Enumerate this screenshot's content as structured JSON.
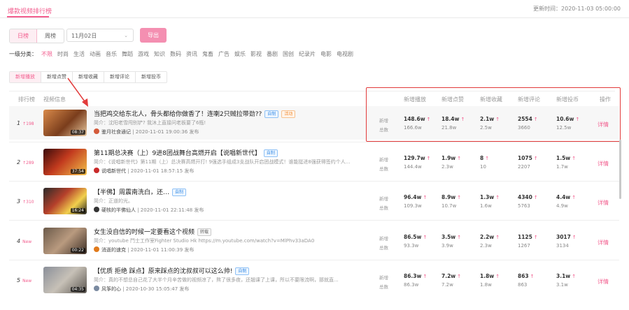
{
  "header": {
    "tab": "爆款视频排行榜",
    "update_label": "更新时间：2020-11-03 05:00:00"
  },
  "filters": {
    "period_tabs": [
      {
        "label": "日榜",
        "active": true
      },
      {
        "label": "周榜",
        "active": false
      }
    ],
    "date_value": "11月02日",
    "export_label": "导出",
    "category_label": "一级分类：",
    "categories": [
      "不限",
      "时尚",
      "生活",
      "动画",
      "音乐",
      "舞蹈",
      "游戏",
      "知识",
      "数码",
      "资讯",
      "鬼畜",
      "广告",
      "娱乐",
      "影视",
      "番剧",
      "国创",
      "纪录片",
      "电影",
      "电视剧"
    ]
  },
  "metric_tabs": [
    "新增播放",
    "新增点赞",
    "新增收藏",
    "新增评论",
    "新增投币"
  ],
  "table": {
    "col_rank": "排行榜",
    "col_info": "视频信息",
    "metric_cols": [
      "新增播放",
      "新增点赞",
      "新增收藏",
      "新增评论",
      "新增投币"
    ],
    "col_action": "操作",
    "label_new": "新增",
    "label_total": "总数",
    "action_label": "详情",
    "rows": [
      {
        "rank": "1",
        "delta": "↑198",
        "title": "当把鸡交给东北人，骨头都给你做香了！连喇2只贼拉带劲??",
        "tags": [
          {
            "t": "自制",
            "c": "blue"
          },
          {
            "t": "活动",
            "c": "orange"
          }
        ],
        "desc": "简介：沈阳老雪闯别铲? 我沐上直接问老板要了6瓶!",
        "author": "鉴月社食通记",
        "meta": " | 2020-11-01 19:00:36 发布",
        "duration": "08:37",
        "metrics": [
          {
            "n": "148.6w",
            "t": "166.6w"
          },
          {
            "n": "18.4w",
            "t": "21.8w"
          },
          {
            "n": "2.1w",
            "t": "2.5w"
          },
          {
            "n": "2554",
            "t": "3660"
          },
          {
            "n": "10.6w",
            "t": "12.5w"
          }
        ]
      },
      {
        "rank": "2",
        "delta": "↑289",
        "title": "第11期总决赛（上）9进8团战舞台高燃开启【说唱新世代】",
        "tags": [
          {
            "t": "自制",
            "c": "blue"
          }
        ],
        "desc": "简介：《说唱新世代》第11期（上）总决赛高燃开打! 9强选手组成3支战队开启团战模式！谁能挺进8强获得签约个人...",
        "author": "说唱新世代",
        "meta": " | 2020-11-01 18:57:15 发布",
        "duration": "37:54",
        "metrics": [
          {
            "n": "129.7w",
            "t": "144.4w"
          },
          {
            "n": "1.9w",
            "t": "2.3w"
          },
          {
            "n": "8",
            "t": "10"
          },
          {
            "n": "1075",
            "t": "2207"
          },
          {
            "n": "1.5w",
            "t": "1.7w"
          }
        ]
      },
      {
        "rank": "3",
        "delta": "↑310",
        "title": "【半佛】周震南洗白，还…",
        "tags": [
          {
            "t": "自制",
            "c": "blue"
          }
        ],
        "desc": "简介：正道的光。",
        "author": "硬核的半佛仙人",
        "meta": " | 2020-11-01 22:11:48 发布",
        "duration": "16:24",
        "metrics": [
          {
            "n": "96.4w",
            "t": "109.3w"
          },
          {
            "n": "8.9w",
            "t": "10.7w"
          },
          {
            "n": "1.3w",
            "t": "1.6w"
          },
          {
            "n": "4340",
            "t": "5763"
          },
          {
            "n": "4.4w",
            "t": "4.9w"
          }
        ]
      },
      {
        "rank": "4",
        "delta": "New",
        "title": "女生没自信的时候一定要看这个视频",
        "tags": [
          {
            "t": "转载",
            "c": "gray"
          }
        ],
        "desc": "简介：youtube 鬥士工作室Fighter Studio Hk https://m.youtube.com/watch?v=MlPhv33aDA0",
        "author": "消逝的速克",
        "meta": " | 2020-11-01 11:00:39 发布",
        "duration": "00:22",
        "metrics": [
          {
            "n": "86.5w",
            "t": "93.3w"
          },
          {
            "n": "3.5w",
            "t": "3.9w"
          },
          {
            "n": "2.2w",
            "t": "2.3w"
          },
          {
            "n": "1125",
            "t": "1267"
          },
          {
            "n": "3017",
            "t": "3134"
          }
        ]
      },
      {
        "rank": "5",
        "delta": "New",
        "title": "【优质 拒绝 踩点】原来踩点的沈叔叔可以这么帅!",
        "tags": [
          {
            "t": "自制",
            "c": "blue"
          }
        ],
        "desc": "简介：真的不想总自己花了大半个月辛苦做的视频凉了，熬了很多夜，还翘课了上课，所以不要限流啊，那就直...",
        "author": "风筝的心",
        "meta": " | 2020-10-30 15:05:47 发布",
        "duration": "04:35",
        "metrics": [
          {
            "n": "86.3w",
            "t": "86.3w"
          },
          {
            "n": "7.2w",
            "t": "7.2w"
          },
          {
            "n": "1.8w",
            "t": "1.8w"
          },
          {
            "n": "863",
            "t": "863"
          },
          {
            "n": "3.1w",
            "t": "3.1w"
          }
        ]
      }
    ]
  },
  "colors": {
    "accent": "#f25d8e",
    "highlight_box": "#e23b3b",
    "annotation_arrow": "#e23b3b"
  }
}
